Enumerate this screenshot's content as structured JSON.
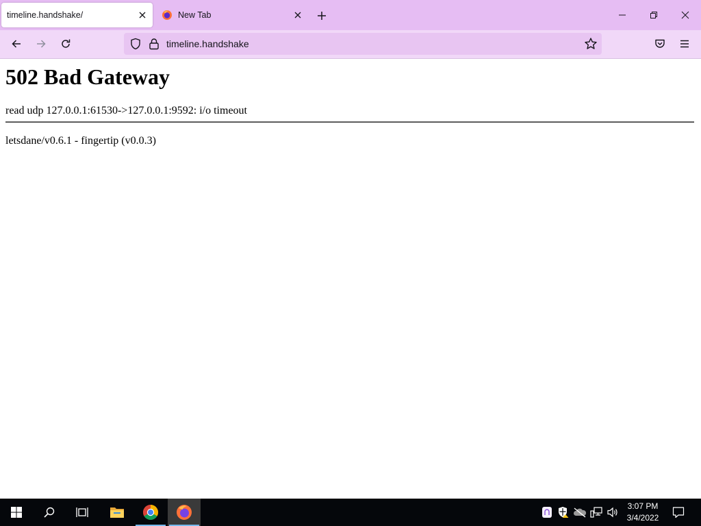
{
  "tabs": [
    {
      "label": "timeline.handshake/",
      "active": true
    },
    {
      "label": "New Tab",
      "active": false
    }
  ],
  "icons": {
    "new_tab": "plus-icon",
    "minimize": "minimize-icon",
    "restore": "restore-icon",
    "close": "close-icon",
    "back": "arrow-left-icon",
    "forward": "arrow-right-icon",
    "reload": "reload-icon",
    "tracking": "shield-icon",
    "lock": "lock-icon",
    "bookmark": "star-icon",
    "pocket": "pocket-icon",
    "menu": "hamburger-menu-icon"
  },
  "urlbar": {
    "url": "timeline.handshake"
  },
  "page": {
    "heading": "502 Bad Gateway",
    "message": "read udp 127.0.0.1:61530->127.0.0.1:9592: i/o timeout",
    "footer": "letsdane/v0.6.1 - fingertip (v0.0.3)"
  },
  "taskbar": {
    "apps": [
      "start-icon",
      "search-icon",
      "task-view-icon",
      "file-explorer-icon",
      "chrome-icon",
      "firefox-icon"
    ],
    "tray": [
      "fingertip-icon",
      "security-icon",
      "onedrive-icon",
      "network-icon",
      "volume-icon"
    ],
    "time": "3:07 PM",
    "date": "3/4/2022"
  },
  "colors": {
    "tabstrip": "#e6bdf3",
    "navbar": "#f1d8f8",
    "urlbar": "#e8c5f2",
    "taskbar": "#05070b",
    "taskbar_indicator": "#76b9ed"
  }
}
